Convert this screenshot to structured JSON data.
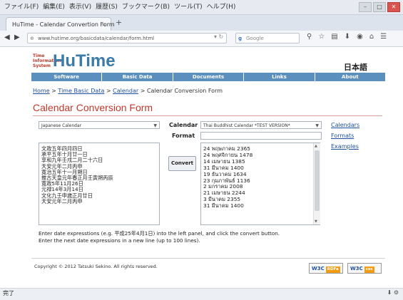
{
  "browser": {
    "menu": [
      "ファイル(F)",
      "編集(E)",
      "表示(V)",
      "履歴(S)",
      "ブックマーク(B)",
      "ツール(T)",
      "ヘルプ(H)"
    ],
    "tab_title": "HuTime - Calendar Convertion Form",
    "url": "www.hutime.org/basicdata/calendar/form.html",
    "search_placeholder": "Google",
    "status": "完了"
  },
  "header": {
    "logo_small": [
      "Time",
      "Information",
      "System"
    ],
    "logo_big": "HuTime",
    "lang": "日本語"
  },
  "nav": [
    "Software",
    "Basic Data",
    "Documents",
    "Links",
    "About"
  ],
  "breadcrumb": {
    "home": "Home",
    "basic": "Time Basic Data",
    "calendar": "Calendar",
    "current": "Calendar Conversion Form"
  },
  "page_title": "Calendar Conversion Form",
  "form": {
    "source_calendar": "Japanese Calendar",
    "calendar_label": "Calendar",
    "target_calendar": "Thai Buddhist Calendar *TEST VERSION*",
    "format_label": "Format",
    "format_value": "",
    "convert_label": "Convert",
    "source_lines": [
      "文政五年四月四日",
      "承平五年十月廿一日",
      "享和九年壬戌二月二十六日",
      "天安元年二月丙申",
      "寛治五年十一月朔日",
      "推古天皇元年春正月壬寅朔丙辰",
      "寛政5年11月26日",
      "元禄14年3月14日",
      "文化九壬申歳正月廿日",
      "天安元年二月丙申"
    ],
    "output_lines": [
      "24  พฤษภาคม  2365",
      "24  พฤศจิกายน  1478",
      "14  เมษายน  1385",
      "31  มีนาคม  1400",
      "19  ธันวาคม  1634",
      "23  กุมภาพันธ์  1136",
      "2  มกราคม  2008",
      "21  เมษายน  2244",
      "3  มีนาคม  2355",
      "31  มีนาคม  1400"
    ]
  },
  "side_links": [
    "Calendars",
    "Formats",
    "Examples"
  ],
  "instructions": [
    "Enter date expresstions (e.g. 平成25年4月1日) into the left panel, and click the convert button.",
    "Enter the next date expressions in a new line (up to 100 lines)."
  ],
  "footer": {
    "copyright": "Copyright © 2012 Tatsuki Sekino. All rights reserved.",
    "badge1": "W3C",
    "badge1_tag": "RDFa",
    "badge2": "W3C",
    "badge2_tag": "css"
  }
}
